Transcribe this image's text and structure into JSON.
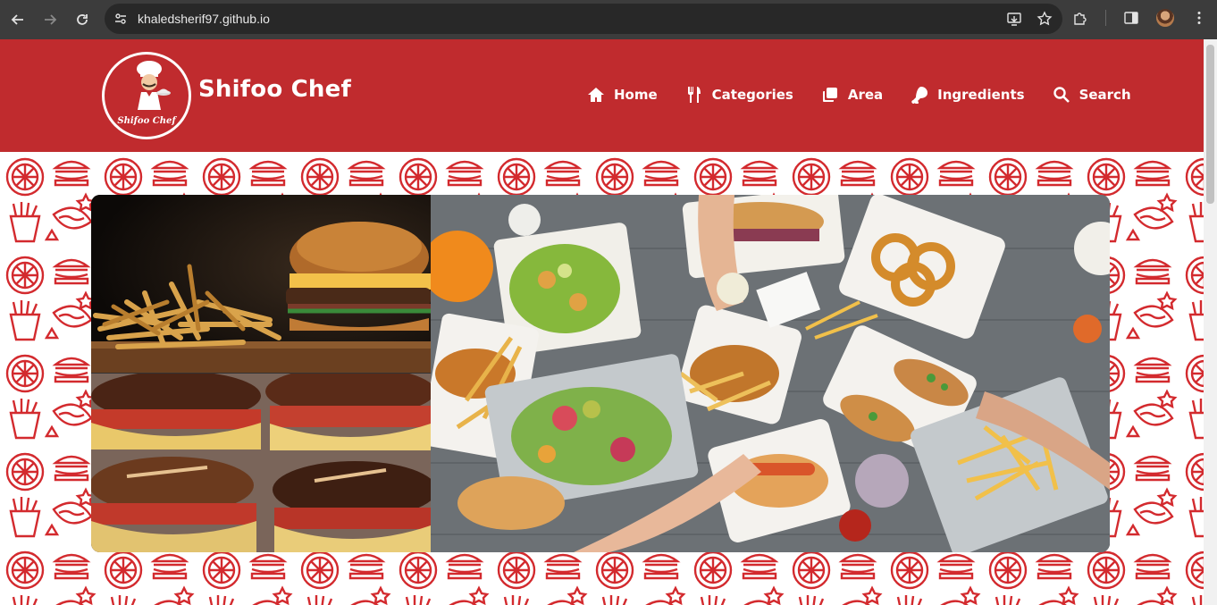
{
  "browser": {
    "url": "khaledsherif97.github.io"
  },
  "site": {
    "brand": "Shifoo Chef",
    "logo_text": "Shifoo Chef"
  },
  "nav": {
    "items": [
      {
        "label": "Home",
        "icon": "home-icon"
      },
      {
        "label": "Categories",
        "icon": "utensils-icon"
      },
      {
        "label": "Area",
        "icon": "clone-icon"
      },
      {
        "label": "Ingredients",
        "icon": "drumstick-icon"
      },
      {
        "label": "Search",
        "icon": "search-icon"
      }
    ]
  },
  "gallery": {
    "images": [
      "burger-fries-image",
      "pretzel-burgers-image",
      "food-spread-image"
    ]
  },
  "colors": {
    "brand_red": "#c02b2e",
    "pattern_red": "#d32a2e",
    "chrome_dark": "#3c3c3c",
    "omnibox": "#282828"
  }
}
